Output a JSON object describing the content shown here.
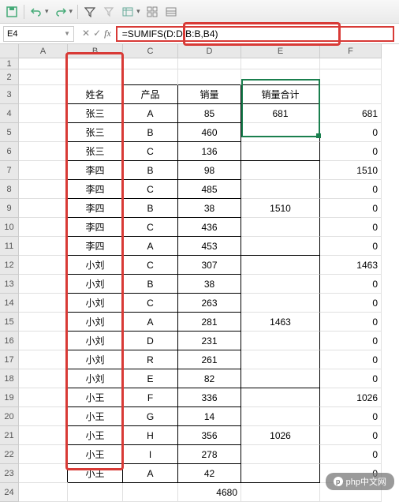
{
  "toolbar": {
    "icons": [
      "save-icon",
      "undo-icon",
      "redo-icon",
      "filter-icon",
      "clear-icon",
      "table-icon",
      "grid-icon",
      "subtotal-icon"
    ]
  },
  "nameBox": "E4",
  "formula": "=SUMIFS(D:D,B:B,B4)",
  "columns": [
    "A",
    "B",
    "C",
    "D",
    "E",
    "F"
  ],
  "headerRow": {
    "B": "姓名",
    "C": "产品",
    "D": "销量",
    "E": "销量合计"
  },
  "rows": [
    {
      "n": 1
    },
    {
      "n": 2
    },
    {
      "n": 3,
      "hdr": true
    },
    {
      "n": 4,
      "B": "张三",
      "C": "A",
      "D": "85",
      "E": "681",
      "F": "681"
    },
    {
      "n": 5,
      "B": "张三",
      "C": "B",
      "D": "460",
      "E": "",
      "F": "0"
    },
    {
      "n": 6,
      "B": "张三",
      "C": "C",
      "D": "136",
      "E": "",
      "F": "0"
    },
    {
      "n": 7,
      "B": "李四",
      "C": "B",
      "D": "98",
      "E": "",
      "F": "1510"
    },
    {
      "n": 8,
      "B": "李四",
      "C": "C",
      "D": "485",
      "E": "",
      "F": "0"
    },
    {
      "n": 9,
      "B": "李四",
      "C": "B",
      "D": "38",
      "E": "1510",
      "F": "0"
    },
    {
      "n": 10,
      "B": "李四",
      "C": "C",
      "D": "436",
      "E": "",
      "F": "0"
    },
    {
      "n": 11,
      "B": "李四",
      "C": "A",
      "D": "453",
      "E": "",
      "F": "0"
    },
    {
      "n": 12,
      "B": "小刘",
      "C": "C",
      "D": "307",
      "E": "",
      "F": "1463"
    },
    {
      "n": 13,
      "B": "小刘",
      "C": "B",
      "D": "38",
      "E": "",
      "F": "0"
    },
    {
      "n": 14,
      "B": "小刘",
      "C": "C",
      "D": "263",
      "E": "",
      "F": "0"
    },
    {
      "n": 15,
      "B": "小刘",
      "C": "A",
      "D": "281",
      "E": "1463",
      "F": "0"
    },
    {
      "n": 16,
      "B": "小刘",
      "C": "D",
      "D": "231",
      "E": "",
      "F": "0"
    },
    {
      "n": 17,
      "B": "小刘",
      "C": "R",
      "D": "261",
      "E": "",
      "F": "0"
    },
    {
      "n": 18,
      "B": "小刘",
      "C": "E",
      "D": "82",
      "E": "",
      "F": "0"
    },
    {
      "n": 19,
      "B": "小王",
      "C": "F",
      "D": "336",
      "E": "",
      "F": "1026"
    },
    {
      "n": 20,
      "B": "小王",
      "C": "G",
      "D": "14",
      "E": "",
      "F": "0"
    },
    {
      "n": 21,
      "B": "小王",
      "C": "H",
      "D": "356",
      "E": "1026",
      "F": "0"
    },
    {
      "n": 22,
      "B": "小王",
      "C": "I",
      "D": "278",
      "E": "",
      "F": "0"
    },
    {
      "n": 23,
      "B": "小王",
      "C": "A",
      "D": "42",
      "E": "",
      "F": "0"
    },
    {
      "n": 24,
      "D": "4680"
    }
  ],
  "mergeGroups": [
    {
      "start": 4,
      "end": 6
    },
    {
      "start": 7,
      "end": 11
    },
    {
      "start": 12,
      "end": 18
    },
    {
      "start": 19,
      "end": 23
    }
  ],
  "watermark": "php中文网"
}
